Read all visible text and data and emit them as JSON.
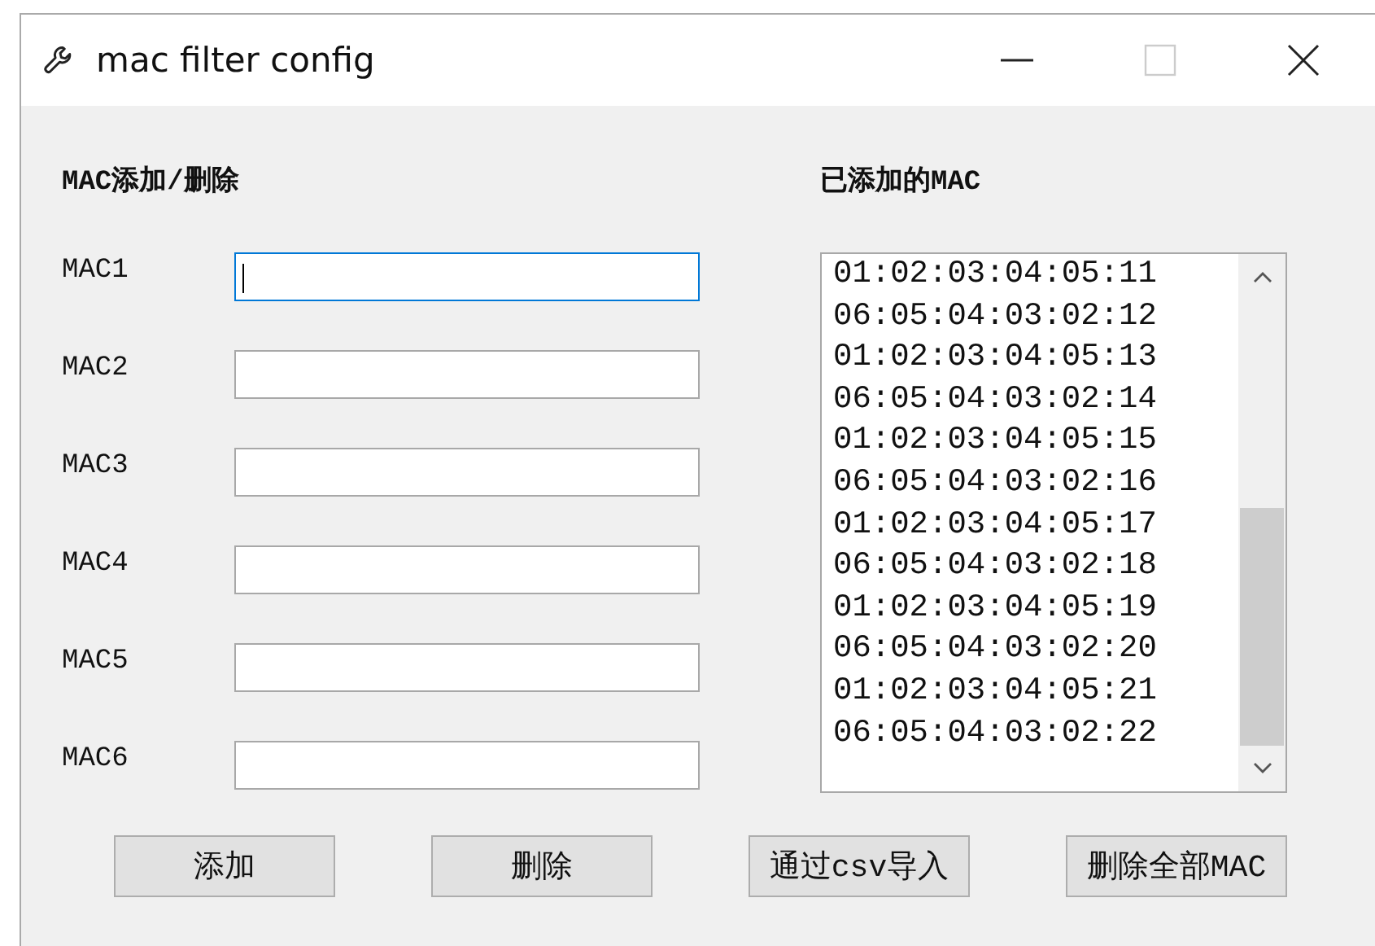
{
  "window": {
    "title": "mac filter config"
  },
  "add_remove": {
    "heading": "MAC添加/删除",
    "fields": [
      {
        "label": "MAC1",
        "focused": true
      },
      {
        "label": "MAC2",
        "focused": false
      },
      {
        "label": "MAC3",
        "focused": false
      },
      {
        "label": "MAC4",
        "focused": false
      },
      {
        "label": "MAC5",
        "focused": false
      },
      {
        "label": "MAC6",
        "focused": false
      }
    ]
  },
  "added": {
    "heading": "已添加的MAC",
    "items": [
      "01:02:03:04:05:11",
      "06:05:04:03:02:12",
      "01:02:03:04:05:13",
      "06:05:04:03:02:14",
      "01:02:03:04:05:15",
      "06:05:04:03:02:16",
      "01:02:03:04:05:17",
      "06:05:04:03:02:18",
      "01:02:03:04:05:19",
      "06:05:04:03:02:20",
      "01:02:03:04:05:21",
      "06:05:04:03:02:22"
    ]
  },
  "buttons": [
    "添加",
    "删除",
    "通过csv导入",
    "删除全部MAC"
  ]
}
